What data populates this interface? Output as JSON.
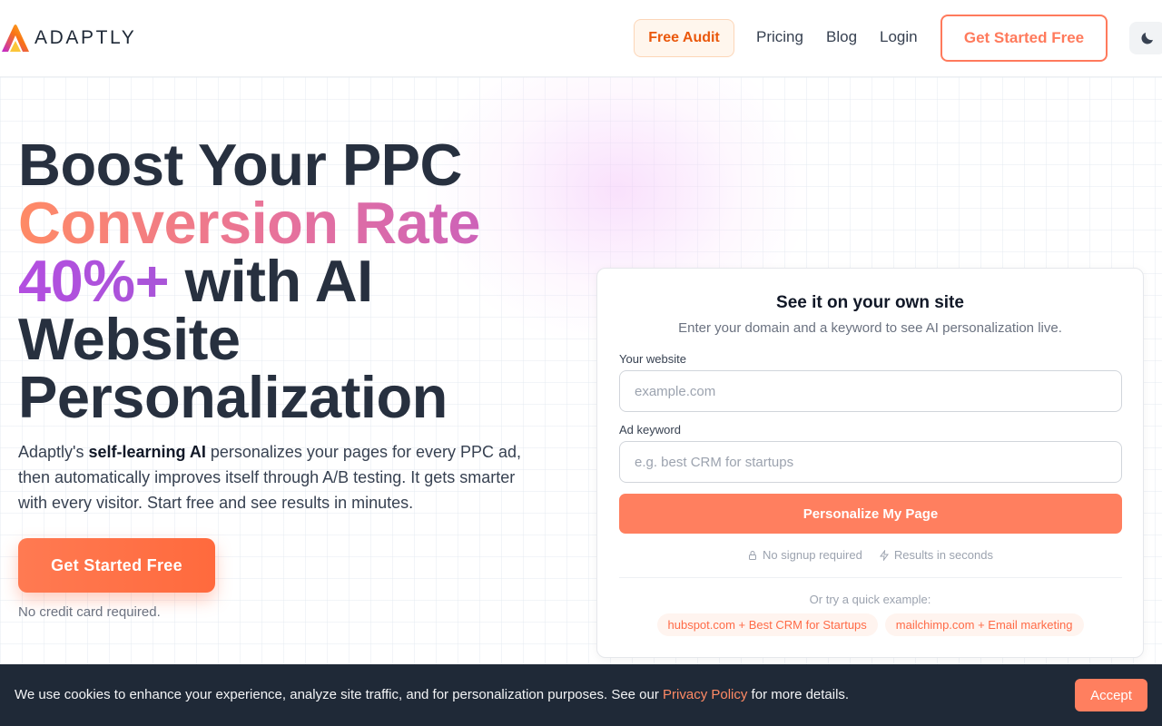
{
  "header": {
    "logo_text": "ADAPTLY",
    "audit_label": "Free Audit",
    "nav": [
      "Pricing",
      "Blog",
      "Login"
    ],
    "cta_label": "Get Started Free",
    "theme_icon": "moon-icon"
  },
  "hero": {
    "title_line1": "Boost Your PPC",
    "title_line2": "Conversion Rate",
    "title_line3_highlight": "40%+",
    "title_line3_rest": " with AI",
    "title_line4": "Website",
    "title_line5": "Personalization",
    "sub_prefix": "Adaptly's ",
    "sub_bold": "self-learning AI",
    "sub_rest": " personalizes your pages for every PPC ad, then automatically improves itself through A/B testing. It gets smarter with every visitor. Start free and see results in minutes.",
    "cta_label": "Get Started Free",
    "note": "No credit card required."
  },
  "card": {
    "title": "See it on your own site",
    "description": "Enter your domain and a keyword to see AI personalization live.",
    "website_label": "Your website",
    "website_placeholder": "example.com",
    "website_value": "",
    "keyword_label": "Ad keyword",
    "keyword_placeholder": "e.g. best CRM for startups",
    "keyword_value": "",
    "submit_label": "Personalize My Page",
    "meta_1": "No signup required",
    "meta_2": "Results in seconds",
    "try_label": "Or try a quick example:",
    "examples": [
      "hubspot.com + Best CRM for Startups",
      "mailchimp.com + Email marketing"
    ]
  },
  "cookie": {
    "text_before": "We use cookies to enhance your experience, analyze site traffic, and for personalization purposes. See our ",
    "link_text": "Privacy Policy",
    "text_after": " for more details.",
    "accept_label": "Accept"
  },
  "colors": {
    "accent": "#ff7a5c",
    "dark": "#1f2937",
    "purple": "#b34ee0"
  }
}
